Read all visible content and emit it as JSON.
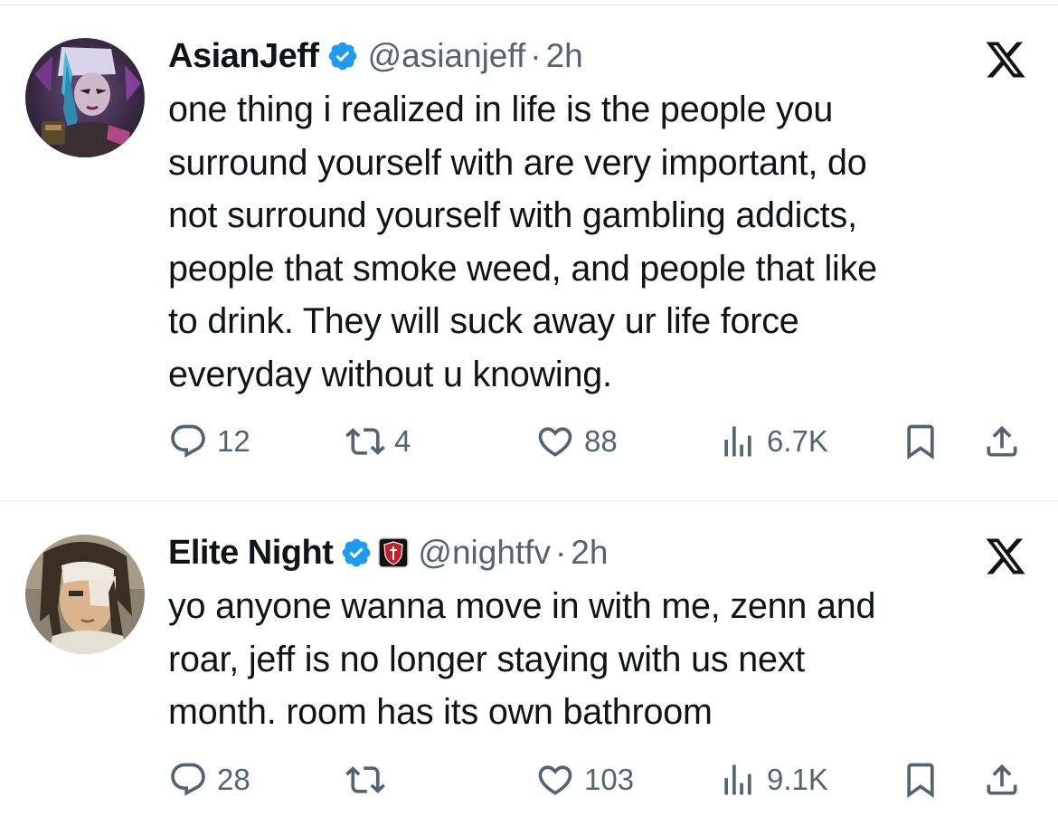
{
  "tweets": [
    {
      "display_name": "AsianJeff",
      "verified": true,
      "handle": "@asianjeff",
      "separator": "·",
      "time": "2h",
      "text_lines": [
        "one thing i realized in life is the people you",
        "surround yourself with are very important, do",
        "not surround yourself with gambling addicts,",
        "people that smoke weed, and people that like",
        "to drink. They will suck away ur life force",
        "everyday without u knowing."
      ],
      "replies": "12",
      "reposts": "4",
      "likes": "88",
      "views": "6.7K"
    },
    {
      "display_name": "Elite Night",
      "verified": true,
      "handle": "@nightfv",
      "separator": "·",
      "time": "2h",
      "text_lines": [
        "yo anyone wanna move in with me, zenn and",
        "roar, jeff is no longer staying with us next",
        "month. room has its own bathroom"
      ],
      "replies": "28",
      "reposts": "",
      "likes": "103",
      "views": "9.1K"
    }
  ],
  "icons": {
    "verified": "verified-badge-icon",
    "affiliate": "affiliate-shield-icon",
    "platform": "x-logo-icon",
    "reply": "reply-icon",
    "repost": "repost-icon",
    "like": "heart-icon",
    "views": "views-icon",
    "bookmark": "bookmark-icon",
    "share": "share-icon"
  },
  "colors": {
    "verified_blue": "#1d9bf0",
    "secondary_text": "#536471",
    "primary_text": "#0f1419",
    "divider": "#eff3f4"
  }
}
